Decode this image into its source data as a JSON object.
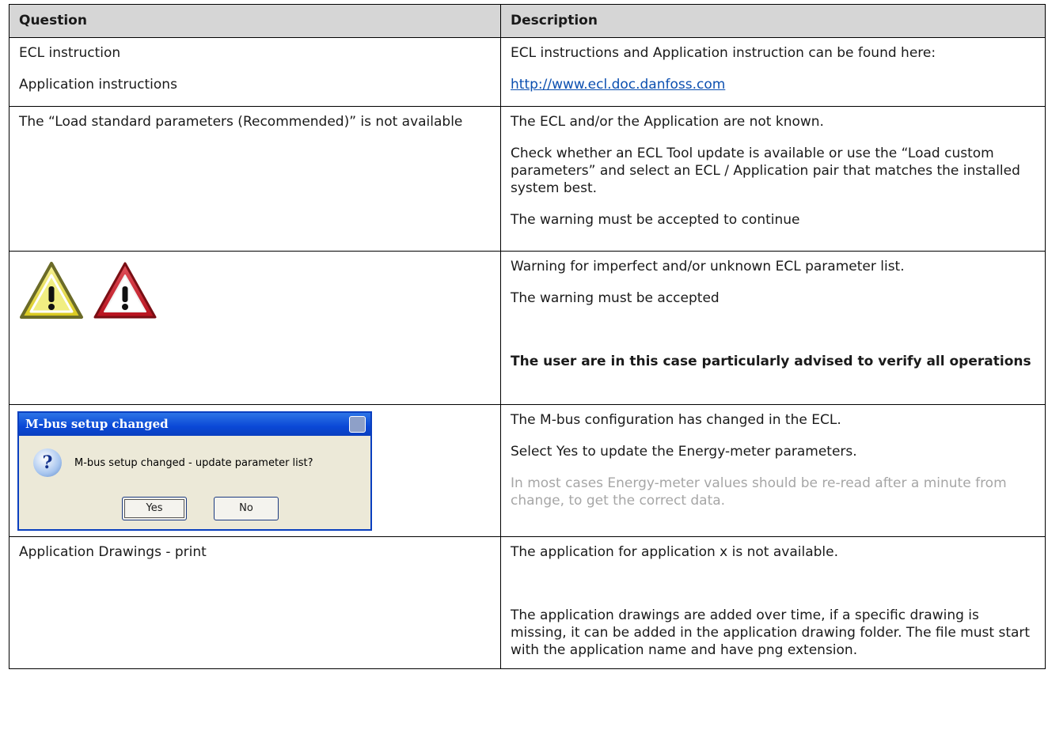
{
  "header": {
    "question": "Question",
    "description": "Description"
  },
  "row1": {
    "q1": "ECL instruction",
    "q2": "Application instructions",
    "d1": "ECL instructions and Application instruction can be found here:",
    "link": "http://www.ecl.doc.danfoss.com"
  },
  "row2": {
    "q": "The “Load standard parameters (Recommended)” is not available",
    "d1": "The ECL and/or the Application are not known.",
    "d2": "Check whether an ECL Tool update is available or use the “Load custom parameters” and select an ECL / Application pair that matches the installed system best.",
    "d3": "The warning must be accepted to continue"
  },
  "row3": {
    "icons": [
      "warning-yellow-icon",
      "warning-red-icon"
    ],
    "d1": "Warning for imperfect and/or unknown ECL parameter list.",
    "d2": "The warning must be accepted",
    "d3": "The user are in this case particularly advised to verify all operations"
  },
  "row4": {
    "dialog": {
      "title": "M-bus setup changed",
      "message": "M-bus setup changed - update parameter list?",
      "yes": "Yes",
      "no": "No",
      "icon": "question-icon"
    },
    "d1": "The M-bus configuration has changed in the ECL.",
    "d2": "Select Yes to update the Energy-meter parameters.",
    "d3": "In most cases Energy-meter values should be re-read after a minute from change, to get the correct data."
  },
  "row5": {
    "q": "Application Drawings - print",
    "d1": "The application for application x is not available.",
    "d2": "The application drawings are added over time, if a specific drawing is missing, it can be added in the application drawing folder. The file must start with the application name and have png extension."
  },
  "colors": {
    "header_bg": "#d6d6d6",
    "link": "#0b4fb0",
    "grey_text": "#a6a6a6",
    "xp_title": "#0a48d6"
  }
}
